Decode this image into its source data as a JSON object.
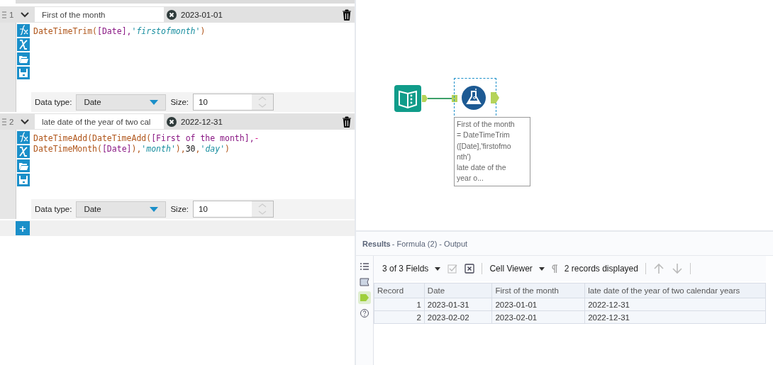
{
  "formulas": [
    {
      "number": "1",
      "expanded": true,
      "output_column": "First of the month",
      "preview": "2023-01-01",
      "expression": [
        [
          {
            "kind": "func",
            "text": "DateTimeTrim("
          },
          {
            "kind": "field",
            "text": "[Date]"
          },
          {
            "kind": "field",
            "text": ","
          },
          {
            "kind": "string",
            "text": "'firstofmonth'"
          },
          {
            "kind": "func",
            "text": ")"
          }
        ]
      ],
      "data_type_label": "Data type:",
      "data_type": "Date",
      "size_label": "Size:",
      "size": "10"
    },
    {
      "number": "2",
      "expanded": true,
      "output_column": "late date of the year of two cal",
      "preview": "2022-12-31",
      "expression": [
        [
          {
            "kind": "func",
            "text": "DateTimeAdd(DateTimeAdd("
          },
          {
            "kind": "field",
            "text": "[First of the month],"
          },
          {
            "kind": "op",
            "text": "-"
          }
        ],
        [
          {
            "kind": "func",
            "text": "DateTimeMonth("
          },
          {
            "kind": "field",
            "text": "[Date]"
          },
          {
            "kind": "func",
            "text": "),"
          },
          {
            "kind": "string",
            "text": "'month'"
          },
          {
            "kind": "func",
            "text": "),"
          },
          {
            "kind": "number",
            "text": "30"
          },
          {
            "kind": "func",
            "text": ","
          },
          {
            "kind": "string",
            "text": "'day'"
          },
          {
            "kind": "func",
            "text": ")"
          }
        ]
      ],
      "data_type_label": "Data type:",
      "data_type": "Date",
      "size_label": "Size:",
      "size": "10"
    }
  ],
  "add_label": "+",
  "canvas": {
    "formula_node_selected": true,
    "annotation": [
      "First of the month",
      "= DateTimeTrim",
      "([Date],'firstofmo",
      "nth')",
      "late date of the",
      "year o..."
    ]
  },
  "results": {
    "title": "Results",
    "subtitle": " - Formula (2) - Output",
    "side_items": [
      {
        "kind": "list",
        "selected": false
      },
      {
        "kind": "tag",
        "selected": false
      },
      {
        "kind": "output",
        "selected": true
      },
      {
        "kind": "help",
        "selected": false
      }
    ],
    "fields": "3 of 3 Fields",
    "viewer": "Cell Viewer",
    "records": "2 records displayed",
    "columns": [
      "Record",
      "Date",
      "First of the month",
      "late date of the year of two calendar years"
    ],
    "rows": [
      [
        "1",
        "2023-01-31",
        "2023-01-01",
        "2022-12-31"
      ],
      [
        "2",
        "2023-02-02",
        "2023-02-01",
        "2022-12-31"
      ]
    ]
  }
}
